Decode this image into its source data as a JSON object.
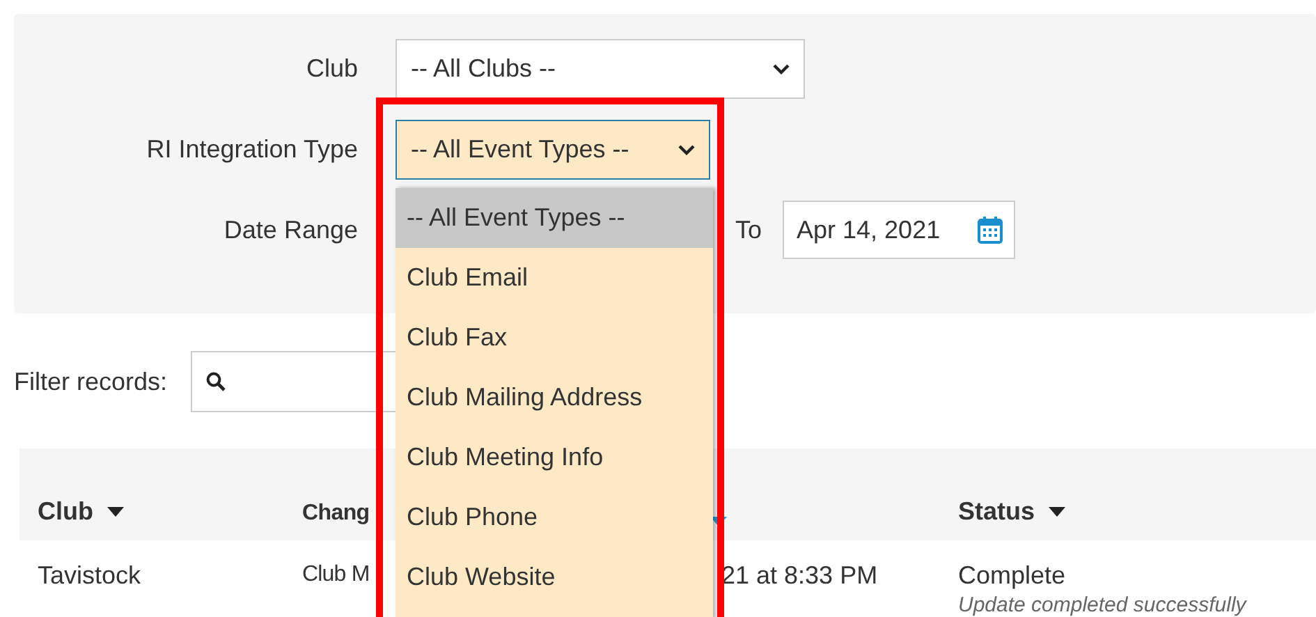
{
  "filters": [
    {
      "kind": "select",
      "label": "Club",
      "value": "-- All Clubs --",
      "open": false
    },
    {
      "kind": "select",
      "label": "RI Integration Type",
      "value": "-- All Event Types --",
      "open": true
    },
    {
      "kind": "daterange",
      "label": "Date Range",
      "to_label": "To",
      "to_value": "Apr 14, 2021"
    }
  ],
  "dropdown": {
    "options": [
      {
        "label": "-- All Event Types --",
        "selected": true
      },
      {
        "label": "Club Email",
        "selected": false
      },
      {
        "label": "Club Fax",
        "selected": false
      },
      {
        "label": "Club Mailing Address",
        "selected": false
      },
      {
        "label": "Club Meeting Info",
        "selected": false
      },
      {
        "label": "Club Phone",
        "selected": false
      },
      {
        "label": "Club Website",
        "selected": false
      }
    ]
  },
  "filter_records": {
    "label": "Filter records:"
  },
  "table": {
    "columns": [
      {
        "label": "Club",
        "sort_icon": true,
        "sort_active": false
      },
      {
        "label": "Chang"
      },
      {
        "sort_icon": true,
        "sort_active": true
      },
      {
        "label": "Status",
        "sort_icon": true,
        "sort_active": false
      }
    ],
    "rows": [
      {
        "cells": [
          [
            "Tavistock"
          ],
          [
            "Club M"
          ],
          [
            "21 at 8:33 PM"
          ],
          [
            "Complete"
          ]
        ],
        "note": "Update completed successfully"
      }
    ]
  }
}
